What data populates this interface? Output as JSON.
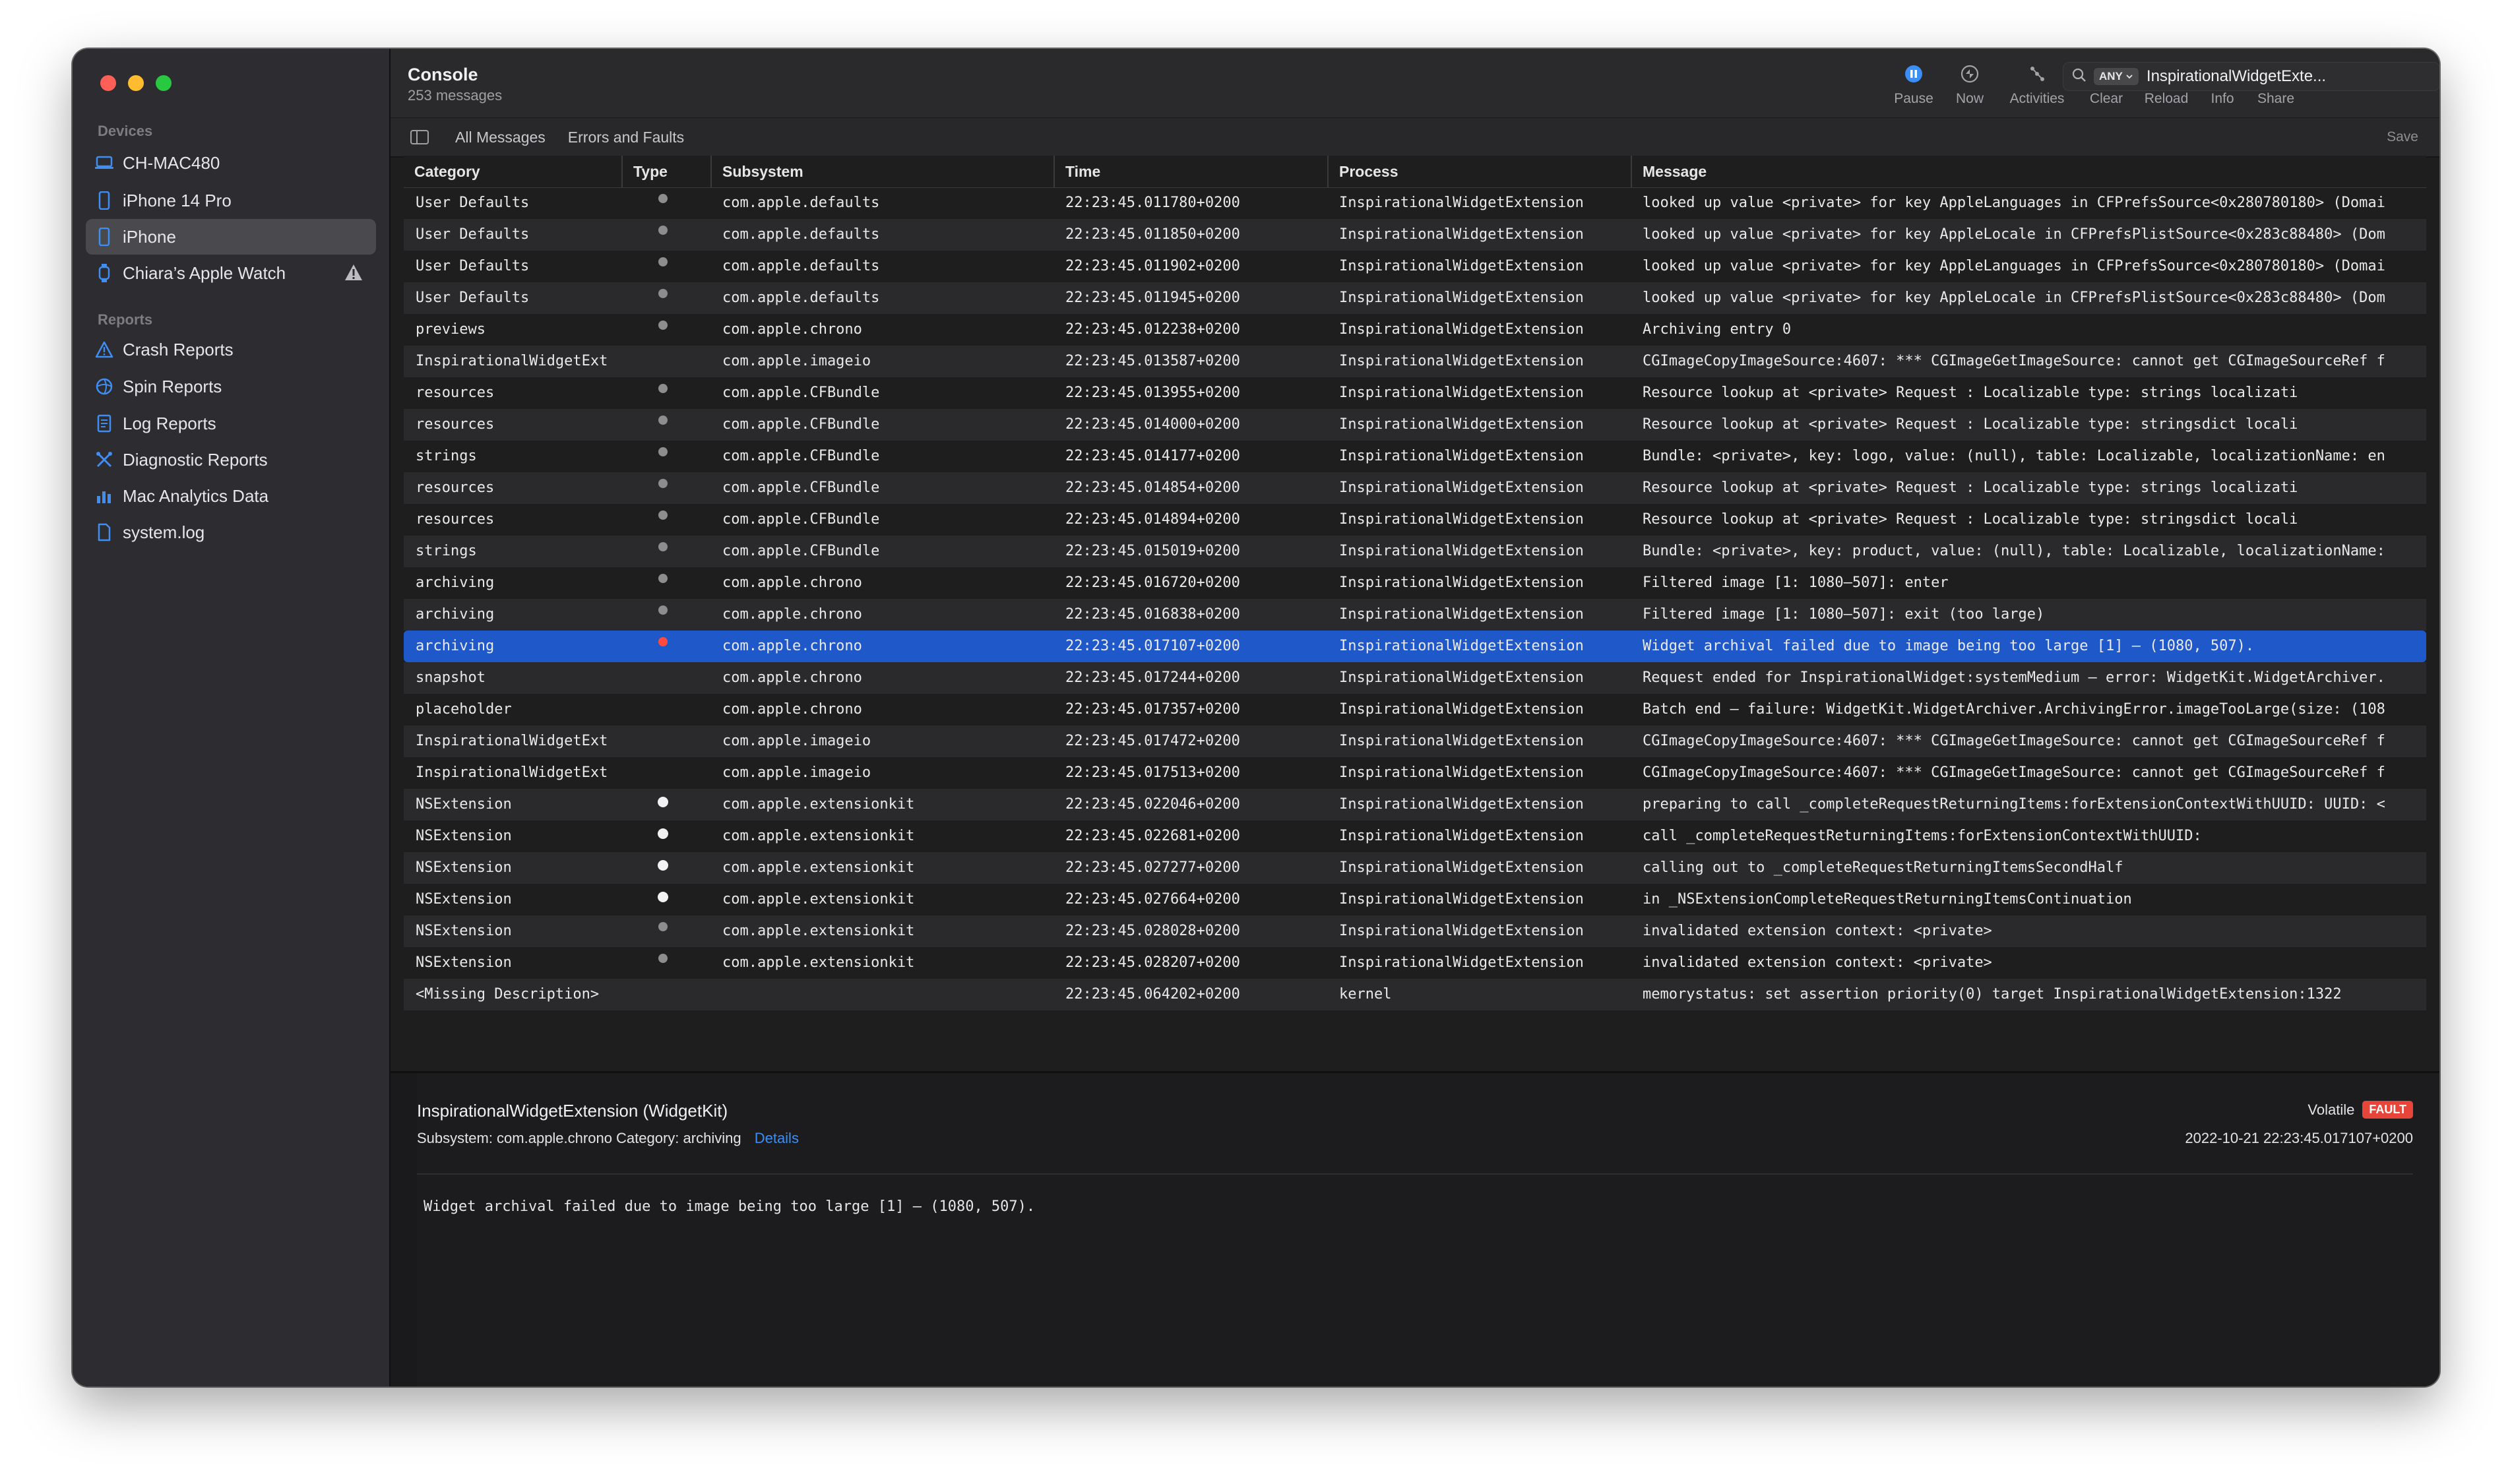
{
  "colors": {
    "accent": "#3b8ef5",
    "selection": "#1f58c9",
    "fault": "#ff4a3d"
  },
  "window": {
    "title": "Console",
    "subtitle": "253 messages"
  },
  "sidebar": {
    "devices_header": "Devices",
    "devices": [
      {
        "label": "CH-MAC480",
        "icon": "laptop-icon"
      },
      {
        "label": "iPhone 14 Pro",
        "icon": "iphone-icon"
      },
      {
        "label": "iPhone",
        "icon": "iphone-icon",
        "selected": true
      },
      {
        "label": "Chiara’s Apple Watch",
        "icon": "watch-icon",
        "warning": true
      }
    ],
    "reports_header": "Reports",
    "reports": [
      {
        "label": "Crash Reports",
        "icon": "warning-triangle-icon"
      },
      {
        "label": "Spin Reports",
        "icon": "spin-icon"
      },
      {
        "label": "Log Reports",
        "icon": "document-icon"
      },
      {
        "label": "Diagnostic Reports",
        "icon": "tools-icon"
      },
      {
        "label": "Mac Analytics Data",
        "icon": "bar-chart-icon"
      },
      {
        "label": "system.log",
        "icon": "file-icon"
      }
    ]
  },
  "toolbar": {
    "pause": "Pause",
    "now": "Now",
    "activities": "Activities",
    "clear": "Clear",
    "reload": "Reload",
    "info": "Info",
    "share": "Share",
    "search_token": "ANY",
    "search_query": "InspirationalWidgetExte..."
  },
  "filterbar": {
    "all_messages": "All Messages",
    "errors_faults": "Errors and Faults",
    "save": "Save"
  },
  "table": {
    "columns": [
      "Category",
      "Type",
      "Subsystem",
      "Time",
      "Process",
      "Message"
    ],
    "rows": [
      {
        "category": "User Defaults",
        "type": "default",
        "subsystem": "com.apple.defaults",
        "time": "22:23:45.011780+0200",
        "process": "InspirationalWidgetExtension",
        "message": "looked up value <private> for key AppleLanguages in CFPrefsSource<0x280780180> (Domai"
      },
      {
        "category": "User Defaults",
        "type": "default",
        "subsystem": "com.apple.defaults",
        "time": "22:23:45.011850+0200",
        "process": "InspirationalWidgetExtension",
        "message": "looked up value <private> for key AppleLocale in CFPrefsPlistSource<0x283c88480> (Dom"
      },
      {
        "category": "User Defaults",
        "type": "default",
        "subsystem": "com.apple.defaults",
        "time": "22:23:45.011902+0200",
        "process": "InspirationalWidgetExtension",
        "message": "looked up value <private> for key AppleLanguages in CFPrefsSource<0x280780180> (Domai"
      },
      {
        "category": "User Defaults",
        "type": "default",
        "subsystem": "com.apple.defaults",
        "time": "22:23:45.011945+0200",
        "process": "InspirationalWidgetExtension",
        "message": "looked up value <private> for key AppleLocale in CFPrefsPlistSource<0x283c88480> (Dom"
      },
      {
        "category": "previews",
        "type": "default",
        "subsystem": "com.apple.chrono",
        "time": "22:23:45.012238+0200",
        "process": "InspirationalWidgetExtension",
        "message": "Archiving entry 0"
      },
      {
        "category": "InspirationalWidgetExt",
        "type": "",
        "subsystem": "com.apple.imageio",
        "time": "22:23:45.013587+0200",
        "process": "InspirationalWidgetExtension",
        "message": "CGImageCopyImageSource:4607: *** CGImageGetImageSource: cannot get CGImageSourceRef f"
      },
      {
        "category": "resources",
        "type": "default",
        "subsystem": "com.apple.CFBundle",
        "time": "22:23:45.013955+0200",
        "process": "InspirationalWidgetExtension",
        "message": "Resource lookup at <private>     Request       : Localizable type: strings localizati"
      },
      {
        "category": "resources",
        "type": "default",
        "subsystem": "com.apple.CFBundle",
        "time": "22:23:45.014000+0200",
        "process": "InspirationalWidgetExtension",
        "message": "Resource lookup at <private>     Request       : Localizable type: stringsdict locali"
      },
      {
        "category": "strings",
        "type": "default",
        "subsystem": "com.apple.CFBundle",
        "time": "22:23:45.014177+0200",
        "process": "InspirationalWidgetExtension",
        "message": "Bundle: <private>, key: logo, value: (null), table: Localizable, localizationName: en"
      },
      {
        "category": "resources",
        "type": "default",
        "subsystem": "com.apple.CFBundle",
        "time": "22:23:45.014854+0200",
        "process": "InspirationalWidgetExtension",
        "message": "Resource lookup at <private>     Request       : Localizable type: strings localizati"
      },
      {
        "category": "resources",
        "type": "default",
        "subsystem": "com.apple.CFBundle",
        "time": "22:23:45.014894+0200",
        "process": "InspirationalWidgetExtension",
        "message": "Resource lookup at <private>     Request       : Localizable type: stringsdict locali"
      },
      {
        "category": "strings",
        "type": "default",
        "subsystem": "com.apple.CFBundle",
        "time": "22:23:45.015019+0200",
        "process": "InspirationalWidgetExtension",
        "message": "Bundle: <private>, key: product, value: (null), table: Localizable, localizationName:"
      },
      {
        "category": "archiving",
        "type": "default",
        "subsystem": "com.apple.chrono",
        "time": "22:23:45.016720+0200",
        "process": "InspirationalWidgetExtension",
        "message": "Filtered image [1: 1080–507]: enter"
      },
      {
        "category": "archiving",
        "type": "default",
        "subsystem": "com.apple.chrono",
        "time": "22:23:45.016838+0200",
        "process": "InspirationalWidgetExtension",
        "message": "Filtered image [1: 1080–507]: exit (too large)"
      },
      {
        "category": "archiving",
        "type": "fault",
        "subsystem": "com.apple.chrono",
        "time": "22:23:45.017107+0200",
        "process": "InspirationalWidgetExtension",
        "message": "Widget archival failed due to image being too large [1] – (1080, 507).",
        "selected": true
      },
      {
        "category": "snapshot",
        "type": "",
        "subsystem": "com.apple.chrono",
        "time": "22:23:45.017244+0200",
        "process": "InspirationalWidgetExtension",
        "message": "Request ended for InspirationalWidget:systemMedium – error: WidgetKit.WidgetArchiver."
      },
      {
        "category": "placeholder",
        "type": "",
        "subsystem": "com.apple.chrono",
        "time": "22:23:45.017357+0200",
        "process": "InspirationalWidgetExtension",
        "message": "Batch end – failure: WidgetKit.WidgetArchiver.ArchivingError.imageTooLarge(size: (108"
      },
      {
        "category": "InspirationalWidgetExt",
        "type": "",
        "subsystem": "com.apple.imageio",
        "time": "22:23:45.017472+0200",
        "process": "InspirationalWidgetExtension",
        "message": "CGImageCopyImageSource:4607: *** CGImageGetImageSource: cannot get CGImageSourceRef f"
      },
      {
        "category": "InspirationalWidgetExt",
        "type": "",
        "subsystem": "com.apple.imageio",
        "time": "22:23:45.017513+0200",
        "process": "InspirationalWidgetExtension",
        "message": "CGImageCopyImageSource:4607: *** CGImageGetImageSource: cannot get CGImageSourceRef f"
      },
      {
        "category": "NSExtension",
        "type": "info",
        "subsystem": "com.apple.extensionkit",
        "time": "22:23:45.022046+0200",
        "process": "InspirationalWidgetExtension",
        "message": "preparing to call _completeRequestReturningItems:forExtensionContextWithUUID: UUID: <"
      },
      {
        "category": "NSExtension",
        "type": "info",
        "subsystem": "com.apple.extensionkit",
        "time": "22:23:45.022681+0200",
        "process": "InspirationalWidgetExtension",
        "message": "call _completeRequestReturningItems:forExtensionContextWithUUID:"
      },
      {
        "category": "NSExtension",
        "type": "info",
        "subsystem": "com.apple.extensionkit",
        "time": "22:23:45.027277+0200",
        "process": "InspirationalWidgetExtension",
        "message": "calling out to _completeRequestReturningItemsSecondHalf"
      },
      {
        "category": "NSExtension",
        "type": "info",
        "subsystem": "com.apple.extensionkit",
        "time": "22:23:45.027664+0200",
        "process": "InspirationalWidgetExtension",
        "message": "in _NSExtensionCompleteRequestReturningItemsContinuation"
      },
      {
        "category": "NSExtension",
        "type": "default",
        "subsystem": "com.apple.extensionkit",
        "time": "22:23:45.028028+0200",
        "process": "InspirationalWidgetExtension",
        "message": "invalidated extension context: <private>"
      },
      {
        "category": "NSExtension",
        "type": "default",
        "subsystem": "com.apple.extensionkit",
        "time": "22:23:45.028207+0200",
        "process": "InspirationalWidgetExtension",
        "message": "invalidated extension context: <private>"
      },
      {
        "category": "<Missing Description>",
        "type": "",
        "subsystem": "",
        "time": "22:23:45.064202+0200",
        "process": "kernel",
        "message": "memorystatus: set assertion priority(0) target InspirationalWidgetExtension:1322"
      }
    ]
  },
  "detail": {
    "title": "InspirationalWidgetExtension (WidgetKit)",
    "meta": "Subsystem: com.apple.chrono   Category: archiving",
    "details_link": "Details",
    "volatile": "Volatile",
    "badge": "FAULT",
    "timestamp": "2022-10-21 22:23:45.017107+0200",
    "message": "Widget archival failed due to image being too large [1] – (1080, 507)."
  }
}
